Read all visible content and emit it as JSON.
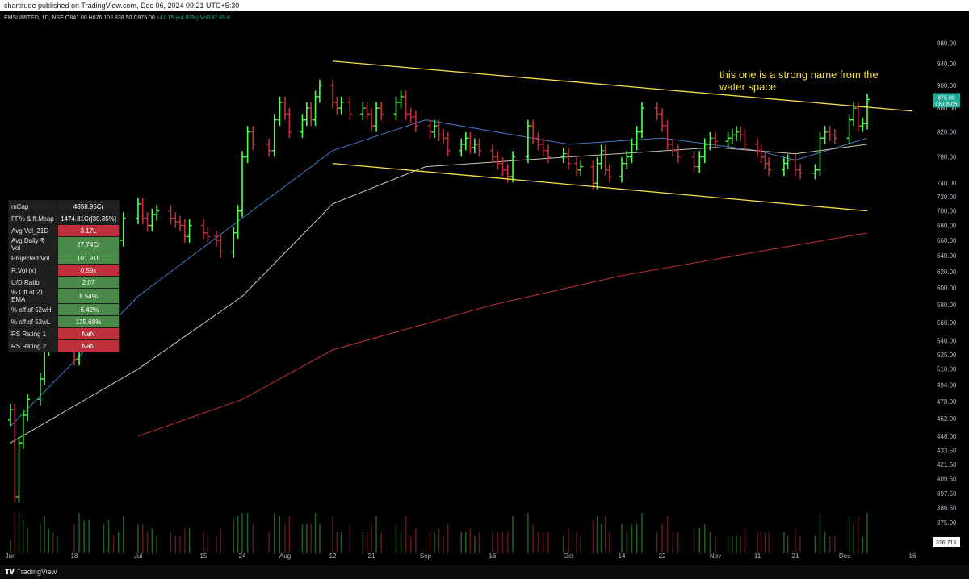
{
  "header": {
    "published": "chartitude published on TradingView.com, Dec 06, 2024 09:21 UTC+5:30"
  },
  "symbol": {
    "name": "EMSLIMITED, 1D, NSE",
    "open": "O841.00",
    "high": "H876.10",
    "low": "L838.50",
    "close": "C875.00",
    "change": "+41.15 (+4.93%)",
    "vol": "Vol187.65 K"
  },
  "annotation": "this one is a strong name from the water space",
  "price_tag": {
    "price": "875.00",
    "countdown": "06:08:05",
    "color": "#22ab94"
  },
  "volume_tag": {
    "label": "316.71K"
  },
  "stats": [
    {
      "label": "mCap",
      "value": "4858.95Cr",
      "tone": "n"
    },
    {
      "label": "FF% & ff.Mcap",
      "value": "1474.81Cr[30.35%]",
      "tone": "n"
    },
    {
      "label": "Avg Vol_21D",
      "value": "3.17L",
      "tone": "r"
    },
    {
      "label": "Avg Daily ₹ Vol",
      "value": "27.74Cr",
      "tone": "g"
    },
    {
      "label": "Projected Vol",
      "value": "101.91L",
      "tone": "g"
    },
    {
      "label": "R.Vol (x)",
      "value": "0.59x",
      "tone": "r"
    },
    {
      "label": "U/D Ratio",
      "value": "2.07",
      "tone": "g"
    },
    {
      "label": "% Off of 21 EMA",
      "value": "8.54%",
      "tone": "g"
    },
    {
      "label": "% off of 52wH",
      "value": "-6.42%",
      "tone": "g"
    },
    {
      "label": "% off of 52wL",
      "value": "135.68%",
      "tone": "g"
    },
    {
      "label": "RS Rating 1",
      "value": "NaN",
      "tone": "r"
    },
    {
      "label": "RS Rating 2",
      "value": "NaN",
      "tone": "r"
    }
  ],
  "footer": {
    "brand": "TradingView"
  },
  "colors": {
    "up": "#4dff4d",
    "down": "#c0303a",
    "ema21": "#4a78c8",
    "sma50": "#c8c8b4",
    "sma200": "#c03030",
    "channel": "#f5e04a"
  },
  "chart_data": {
    "type": "bar",
    "title": "",
    "x_ticks": [
      "Jun",
      "18",
      "Jul",
      "15",
      "24",
      "Aug",
      "12",
      "21",
      "Sep",
      "16",
      "Oct",
      "14",
      "22",
      "Nov",
      "11",
      "21",
      "Dec",
      "16"
    ],
    "x_tick_dates": [
      "2024-06-03",
      "2024-06-18",
      "2024-07-01",
      "2024-07-15",
      "2024-07-24",
      "2024-08-01",
      "2024-08-12",
      "2024-08-21",
      "2024-09-01",
      "2024-09-16",
      "2024-10-01",
      "2024-10-14",
      "2024-10-22",
      "2024-11-01",
      "2024-11-11",
      "2024-11-21",
      "2024-12-01",
      "2024-12-16"
    ],
    "y_ticks": [
      "980.00",
      "940.00",
      "900.00",
      "860.00",
      "820.00",
      "780.00",
      "740.00",
      "720.00",
      "700.00",
      "680.00",
      "660.00",
      "640.00",
      "620.00",
      "600.00",
      "580.00",
      "560.00",
      "540.00",
      "525.00",
      "510.00",
      "494.00",
      "478.00",
      "462.00",
      "446.00",
      "433.50",
      "421.50",
      "409.50",
      "397.50",
      "386.50",
      "375.00"
    ],
    "y_scale": "log",
    "series": [
      {
        "type": "ohlc",
        "points": [
          {
            "date": "2024-06-03",
            "close": 470
          },
          {
            "date": "2024-06-04",
            "close": 395
          },
          {
            "date": "2024-06-05",
            "close": 440
          },
          {
            "date": "2024-06-06",
            "close": 465
          },
          {
            "date": "2024-06-07",
            "close": 480
          },
          {
            "date": "2024-06-10",
            "close": 500
          },
          {
            "date": "2024-06-11",
            "close": 530
          },
          {
            "date": "2024-06-12",
            "close": 545
          },
          {
            "date": "2024-06-13",
            "close": 535
          },
          {
            "date": "2024-06-14",
            "close": 540
          },
          {
            "date": "2024-06-18",
            "close": 520
          },
          {
            "date": "2024-06-19",
            "close": 560
          },
          {
            "date": "2024-06-20",
            "close": 585
          },
          {
            "date": "2024-06-21",
            "close": 610
          },
          {
            "date": "2024-06-24",
            "close": 630
          },
          {
            "date": "2024-06-25",
            "close": 655
          },
          {
            "date": "2024-06-26",
            "close": 650
          },
          {
            "date": "2024-06-27",
            "close": 660
          },
          {
            "date": "2024-06-28",
            "close": 690
          },
          {
            "date": "2024-07-01",
            "close": 710
          },
          {
            "date": "2024-07-02",
            "close": 690
          },
          {
            "date": "2024-07-03",
            "close": 680
          },
          {
            "date": "2024-07-04",
            "close": 695
          },
          {
            "date": "2024-07-05",
            "close": 700
          },
          {
            "date": "2024-07-08",
            "close": 690
          },
          {
            "date": "2024-07-09",
            "close": 685
          },
          {
            "date": "2024-07-10",
            "close": 680
          },
          {
            "date": "2024-07-11",
            "close": 665
          },
          {
            "date": "2024-07-12",
            "close": 680
          },
          {
            "date": "2024-07-15",
            "close": 670
          },
          {
            "date": "2024-07-16",
            "close": 665
          },
          {
            "date": "2024-07-18",
            "close": 660
          },
          {
            "date": "2024-07-19",
            "close": 645
          },
          {
            "date": "2024-07-22",
            "close": 670
          },
          {
            "date": "2024-07-23",
            "close": 700
          },
          {
            "date": "2024-07-24",
            "close": 780
          },
          {
            "date": "2024-07-25",
            "close": 820
          },
          {
            "date": "2024-07-26",
            "close": 800
          },
          {
            "date": "2024-07-29",
            "close": 790
          },
          {
            "date": "2024-07-30",
            "close": 840
          },
          {
            "date": "2024-07-31",
            "close": 870
          },
          {
            "date": "2024-08-01",
            "close": 850
          },
          {
            "date": "2024-08-02",
            "close": 820
          },
          {
            "date": "2024-08-05",
            "close": 840
          },
          {
            "date": "2024-08-06",
            "close": 860
          },
          {
            "date": "2024-08-07",
            "close": 840
          },
          {
            "date": "2024-08-08",
            "close": 880
          },
          {
            "date": "2024-08-09",
            "close": 900
          },
          {
            "date": "2024-08-12",
            "close": 870
          },
          {
            "date": "2024-08-13",
            "close": 860
          },
          {
            "date": "2024-08-14",
            "close": 870
          },
          {
            "date": "2024-08-16",
            "close": 850
          },
          {
            "date": "2024-08-19",
            "close": 860
          },
          {
            "date": "2024-08-20",
            "close": 850
          },
          {
            "date": "2024-08-21",
            "close": 830
          },
          {
            "date": "2024-08-22",
            "close": 860
          },
          {
            "date": "2024-08-23",
            "close": 850
          },
          {
            "date": "2024-08-26",
            "close": 870
          },
          {
            "date": "2024-08-27",
            "close": 880
          },
          {
            "date": "2024-08-28",
            "close": 850
          },
          {
            "date": "2024-08-29",
            "close": 845
          },
          {
            "date": "2024-08-30",
            "close": 830
          },
          {
            "date": "2024-09-02",
            "close": 820
          },
          {
            "date": "2024-09-03",
            "close": 830
          },
          {
            "date": "2024-09-04",
            "close": 815
          },
          {
            "date": "2024-09-05",
            "close": 810
          },
          {
            "date": "2024-09-06",
            "close": 790
          },
          {
            "date": "2024-09-09",
            "close": 800
          },
          {
            "date": "2024-09-10",
            "close": 810
          },
          {
            "date": "2024-09-11",
            "close": 795
          },
          {
            "date": "2024-09-12",
            "close": 800
          },
          {
            "date": "2024-09-13",
            "close": 790
          },
          {
            "date": "2024-09-16",
            "close": 780
          },
          {
            "date": "2024-09-17",
            "close": 770
          },
          {
            "date": "2024-09-18",
            "close": 760
          },
          {
            "date": "2024-09-19",
            "close": 750
          },
          {
            "date": "2024-09-20",
            "close": 780
          },
          {
            "date": "2024-09-23",
            "close": 830
          },
          {
            "date": "2024-09-24",
            "close": 810
          },
          {
            "date": "2024-09-25",
            "close": 800
          },
          {
            "date": "2024-09-26",
            "close": 790
          },
          {
            "date": "2024-09-27",
            "close": 780
          },
          {
            "date": "2024-09-30",
            "close": 785
          },
          {
            "date": "2024-10-01",
            "close": 770
          },
          {
            "date": "2024-10-03",
            "close": 760
          },
          {
            "date": "2024-10-04",
            "close": 765
          },
          {
            "date": "2024-10-07",
            "close": 740
          },
          {
            "date": "2024-10-08",
            "close": 770
          },
          {
            "date": "2024-10-09",
            "close": 790
          },
          {
            "date": "2024-10-10",
            "close": 760
          },
          {
            "date": "2024-10-11",
            "close": 750
          },
          {
            "date": "2024-10-14",
            "close": 770
          },
          {
            "date": "2024-10-15",
            "close": 780
          },
          {
            "date": "2024-10-16",
            "close": 800
          },
          {
            "date": "2024-10-17",
            "close": 820
          },
          {
            "date": "2024-10-18",
            "close": 860
          },
          {
            "date": "2024-10-21",
            "close": 850
          },
          {
            "date": "2024-10-22",
            "close": 830
          },
          {
            "date": "2024-10-23",
            "close": 800
          },
          {
            "date": "2024-10-24",
            "close": 790
          },
          {
            "date": "2024-10-25",
            "close": 780
          },
          {
            "date": "2024-10-28",
            "close": 765
          },
          {
            "date": "2024-10-29",
            "close": 780
          },
          {
            "date": "2024-10-30",
            "close": 800
          },
          {
            "date": "2024-10-31",
            "close": 810
          },
          {
            "date": "2024-11-01",
            "close": 805
          },
          {
            "date": "2024-11-04",
            "close": 810
          },
          {
            "date": "2024-11-05",
            "close": 815
          },
          {
            "date": "2024-11-06",
            "close": 820
          },
          {
            "date": "2024-11-07",
            "close": 815
          },
          {
            "date": "2024-11-08",
            "close": 800
          },
          {
            "date": "2024-11-11",
            "close": 790
          },
          {
            "date": "2024-11-12",
            "close": 780
          },
          {
            "date": "2024-11-13",
            "close": 770
          },
          {
            "date": "2024-11-14",
            "close": 760
          },
          {
            "date": "2024-11-18",
            "close": 770
          },
          {
            "date": "2024-11-19",
            "close": 775
          },
          {
            "date": "2024-11-21",
            "close": 760
          },
          {
            "date": "2024-11-22",
            "close": 755
          },
          {
            "date": "2024-11-25",
            "close": 760
          },
          {
            "date": "2024-11-26",
            "close": 810
          },
          {
            "date": "2024-11-27",
            "close": 820
          },
          {
            "date": "2024-11-28",
            "close": 815
          },
          {
            "date": "2024-11-29",
            "close": 810
          },
          {
            "date": "2024-12-02",
            "close": 840
          },
          {
            "date": "2024-12-03",
            "close": 860
          },
          {
            "date": "2024-12-04",
            "close": 830
          },
          {
            "date": "2024-12-05",
            "close": 834
          },
          {
            "date": "2024-12-06",
            "close": 875
          }
        ]
      },
      {
        "type": "line",
        "points": [
          [
            "2024-06-03",
            455
          ],
          [
            "2024-07-01",
            590
          ],
          [
            "2024-07-24",
            690
          ],
          [
            "2024-08-12",
            790
          ],
          [
            "2024-09-01",
            840
          ],
          [
            "2024-10-01",
            800
          ],
          [
            "2024-10-22",
            810
          ],
          [
            "2024-11-11",
            790
          ],
          [
            "2024-11-21",
            775
          ],
          [
            "2024-12-06",
            810
          ]
        ]
      },
      {
        "type": "line",
        "points": [
          [
            "2024-06-03",
            440
          ],
          [
            "2024-07-01",
            510
          ],
          [
            "2024-07-24",
            590
          ],
          [
            "2024-08-12",
            710
          ],
          [
            "2024-09-01",
            765
          ],
          [
            "2024-10-01",
            780
          ],
          [
            "2024-11-01",
            795
          ],
          [
            "2024-11-21",
            785
          ],
          [
            "2024-12-06",
            800
          ]
        ]
      },
      {
        "type": "line",
        "points": [
          [
            "2024-07-01",
            446
          ],
          [
            "2024-07-24",
            480
          ],
          [
            "2024-08-12",
            530
          ],
          [
            "2024-09-16",
            580
          ],
          [
            "2024-10-14",
            615
          ],
          [
            "2024-11-11",
            645
          ],
          [
            "2024-12-06",
            670
          ]
        ]
      }
    ],
    "trendlines": [
      {
        "from": [
          "2024-08-12",
          945
        ],
        "to": [
          "2024-12-16",
          855
        ]
      },
      {
        "from": [
          "2024-08-12",
          770
        ],
        "to": [
          "2024-12-06",
          700
        ]
      }
    ],
    "volume_max_label": "316.71K"
  }
}
